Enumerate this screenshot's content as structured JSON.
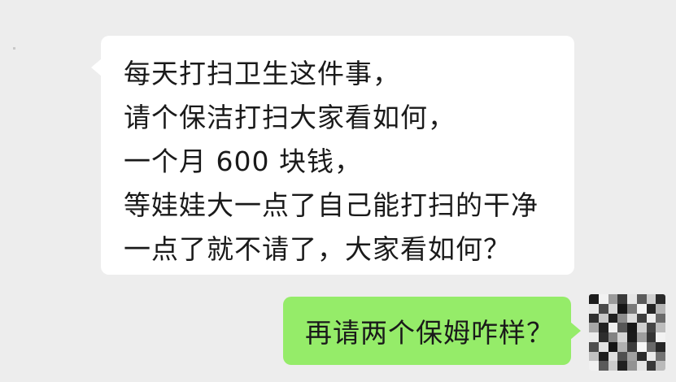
{
  "chat": {
    "received": {
      "lines": [
        "每天打扫卫生这件事，",
        "请个保洁打扫大家看如何，",
        "一个月 600 块钱，",
        "等娃娃大一点了自己能打扫的干净",
        "一点了就不请了，大家看如何？"
      ]
    },
    "sent": {
      "text": "再请两个保姆咋样？"
    }
  },
  "colors": {
    "background": "#ededed",
    "received_bubble": "#ffffff",
    "sent_bubble": "#95ec69",
    "text": "#1a1a1a"
  },
  "avatar": {
    "icon": "pixelated-avatar-icon"
  }
}
